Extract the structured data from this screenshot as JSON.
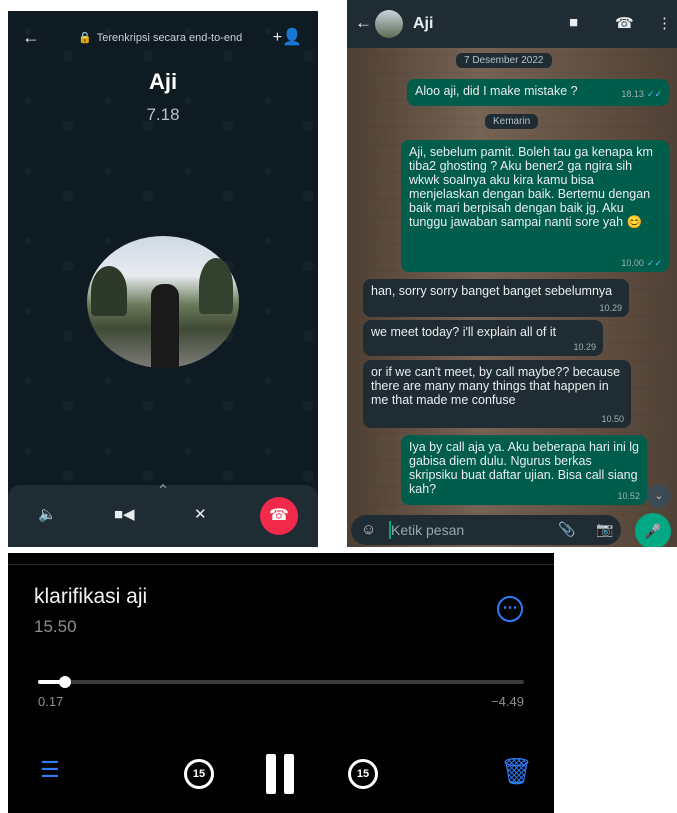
{
  "call": {
    "encryption_text": "Terenkripsi secara end-to-end",
    "name": "Aji",
    "duration": "7.18"
  },
  "chat": {
    "contact_name": "Aji",
    "input_placeholder": "Ketik pesan",
    "date_labels": [
      "7 Desember 2022",
      "Kemarin"
    ],
    "messages": [
      {
        "dir": "out",
        "text": "Aloo aji, did I make mistake ?",
        "time": "18.13",
        "read": true
      },
      {
        "dir": "out",
        "text": "Aji, sebelum pamit. Boleh tau ga kenapa km tiba2 ghosting ? Aku bener2 ga ngira sih wkwk soalnya aku kira kamu bisa menjelaskan dengan baik. Bertemu dengan baik mari berpisah dengan baik jg. Aku tunggu jawaban sampai nanti sore yah 😊",
        "time": "10.00",
        "read": true
      },
      {
        "dir": "in",
        "text": "han, sorry sorry banget banget sebelumnya",
        "time": "10.29"
      },
      {
        "dir": "in",
        "text": "we meet today? i'll explain all of it",
        "time": "10.29"
      },
      {
        "dir": "in",
        "text": "or if we can't meet, by call maybe?? because there are many many things that happen in me that made me confuse",
        "time": "10.50"
      },
      {
        "dir": "out",
        "text": "Iya by call aja ya. Aku beberapa hari ini lg gabisa diem dulu. Ngurus berkas skripsiku buat daftar ujian. Bisa call siang kah?",
        "time": "10.52",
        "read": false
      }
    ]
  },
  "recorder": {
    "title": "klarifikasi aji",
    "duration": "15.50",
    "elapsed": "0.17",
    "remaining": "−4.49",
    "progress": 0.055,
    "skip_seconds": "15"
  },
  "colors": {
    "whatsapp_dark": "#1f2c34",
    "outgoing_bubble": "#005c4b",
    "end_call_red": "#f1294a",
    "ios_blue": "#2d7cf6",
    "accent_green": "#00a884"
  }
}
